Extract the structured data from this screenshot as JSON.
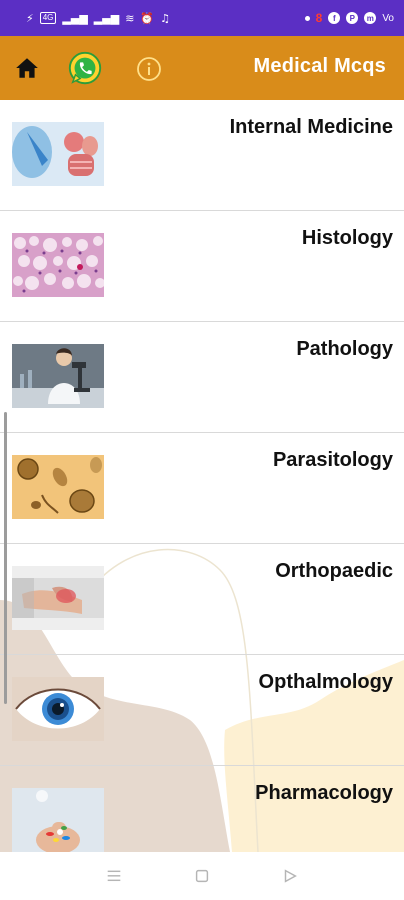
{
  "status_bar": {
    "left_glyphs": [
      "⚡",
      "4G",
      "▂▄▆",
      "▂▄▆",
      "📶",
      "⏰",
      "🔔"
    ],
    "right_glyphs": [
      "•",
      "8",
      "f",
      "P",
      "m"
    ],
    "battery": "Vo"
  },
  "app_bar": {
    "title": "Medical Mcqs",
    "home_icon": "home-icon",
    "whatsapp_icon": "whatsapp-icon",
    "info_icon": "info-icon",
    "accent_color": "#d98c1a"
  },
  "subjects": [
    {
      "label": "Internal Medicine",
      "thumb": "organs-illustration"
    },
    {
      "label": "Histology",
      "thumb": "tissue-micrograph"
    },
    {
      "label": "Pathology",
      "thumb": "lab-microscope-photo"
    },
    {
      "label": "Parasitology",
      "thumb": "parasite-eggs-photo"
    },
    {
      "label": "Orthopaedic",
      "thumb": "wrist-injury-photo"
    },
    {
      "label": "Opthalmology",
      "thumb": "eye-closeup-photo"
    },
    {
      "label": "Pharmacology",
      "thumb": "pills-in-hand-photo"
    }
  ],
  "nav_bar": {
    "buttons": [
      "menu-icon",
      "home-square-icon",
      "back-triangle-icon"
    ]
  }
}
